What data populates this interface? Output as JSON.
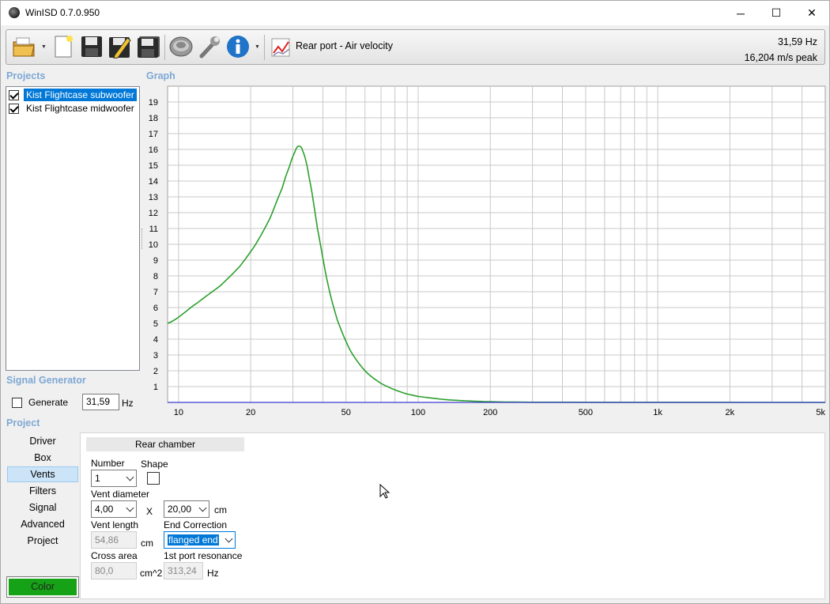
{
  "window": {
    "title": "WinISD 0.7.0.950",
    "min": "─",
    "max": "☐",
    "close": "✕"
  },
  "toolbar": {
    "graph_select": "Rear port - Air velocity",
    "freq_readout": "31,59 Hz",
    "value_readout": "16,204 m/s peak",
    "icons": [
      "open-folder-icon",
      "new-document-icon",
      "save-icon",
      "edit-icon",
      "save-all-icon",
      "driver-icon",
      "wrench-icon",
      "info-icon",
      "graph-icon"
    ]
  },
  "sections": {
    "projects": "Projects",
    "graph": "Graph",
    "signal_generator": "Signal Generator",
    "project": "Project"
  },
  "projects": [
    {
      "name": "Kist Flightcase subwoofer",
      "checked": true,
      "selected": true
    },
    {
      "name": "Kist Flightcase midwoofer",
      "checked": true,
      "selected": false
    }
  ],
  "signal": {
    "generate_label": "Generate",
    "generate_checked": false,
    "freq": "31,59",
    "unit": "Hz"
  },
  "nav": [
    "Driver",
    "Box",
    "Vents",
    "Filters",
    "Signal",
    "Advanced",
    "Project"
  ],
  "nav_active": "Vents",
  "color_label": "Color",
  "vents": {
    "chamber_tab": "Rear chamber",
    "number_label": "Number",
    "number_value": "1",
    "shape_label": "Shape",
    "diameter_label": "Vent diameter",
    "diameter_value": "4,00",
    "x": "X",
    "width_value": "20,00",
    "cm": "cm",
    "length_label": "Vent length",
    "length_value": "54,86",
    "length_unit": "cm",
    "end_corr_label": "End Correction",
    "end_corr_value": "flanged end",
    "cross_area_label": "Cross area",
    "cross_area_value": "80,0",
    "cross_area_unit": "cm^2",
    "resonance_label": "1st port resonance",
    "resonance_value": "313,24",
    "resonance_unit": "Hz"
  },
  "chart_data": {
    "type": "line",
    "xscale": "log",
    "xlim": [
      9,
      5000
    ],
    "ylim": [
      0,
      20
    ],
    "x_ticks": [
      "10",
      "20",
      "50",
      "100",
      "200",
      "500",
      "1k",
      "2k",
      "5k"
    ],
    "y_ticks": [
      "1",
      "2",
      "3",
      "4",
      "5",
      "6",
      "7",
      "8",
      "9",
      "10",
      "11",
      "12",
      "13",
      "14",
      "15",
      "16",
      "17",
      "18",
      "19"
    ],
    "grid": true,
    "series": [
      {
        "color": "#2ca02c",
        "x": [
          9,
          12,
          15,
          18,
          21,
          24,
          27,
          29,
          30.5,
          31.59,
          33,
          35,
          38,
          42,
          46,
          52,
          60,
          70,
          85,
          100,
          130,
          170,
          220,
          300,
          5000
        ],
        "y": [
          5.0,
          6.3,
          7.4,
          8.6,
          10.0,
          11.6,
          13.5,
          14.9,
          15.8,
          16.2,
          15.9,
          14.3,
          11.0,
          7.5,
          5.2,
          3.3,
          2.0,
          1.2,
          0.65,
          0.38,
          0.18,
          0.08,
          0.03,
          0.01,
          0.0
        ]
      },
      {
        "color": "#3a3ad0",
        "x": [
          9,
          5000
        ],
        "y": [
          0.0,
          0.0
        ]
      }
    ]
  }
}
